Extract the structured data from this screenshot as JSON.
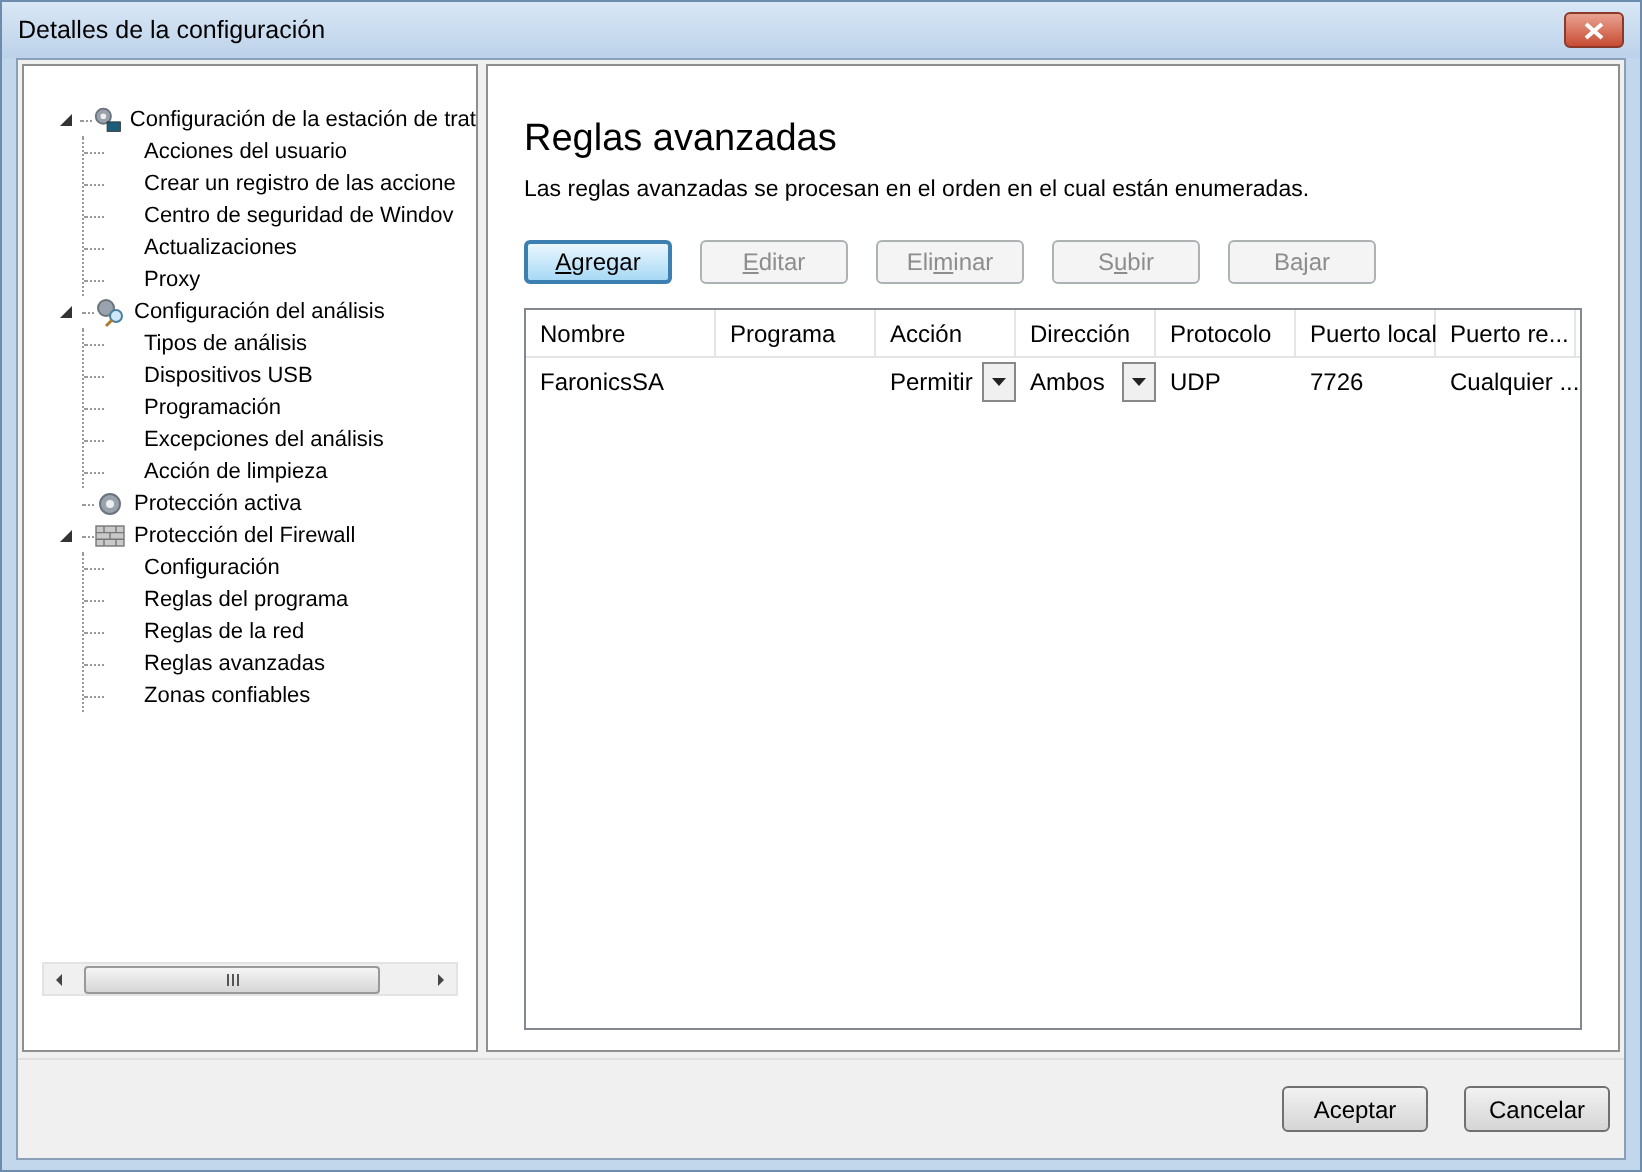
{
  "window": {
    "title": "Detalles de la configuración"
  },
  "tree": [
    {
      "label": "Configuración de la estación de trat",
      "expanded": true,
      "children": [
        {
          "label": "Acciones del usuario"
        },
        {
          "label": "Crear un registro de las accione"
        },
        {
          "label": "Centro de seguridad de Windov"
        },
        {
          "label": "Actualizaciones"
        },
        {
          "label": "Proxy"
        }
      ]
    },
    {
      "label": "Configuración del análisis",
      "expanded": true,
      "children": [
        {
          "label": "Tipos de análisis"
        },
        {
          "label": "Dispositivos USB"
        },
        {
          "label": "Programación"
        },
        {
          "label": "Excepciones del análisis"
        },
        {
          "label": "Acción de limpieza"
        }
      ]
    },
    {
      "label": "Protección activa"
    },
    {
      "label": "Protección del Firewall",
      "expanded": true,
      "children": [
        {
          "label": "Configuración"
        },
        {
          "label": "Reglas del  programa"
        },
        {
          "label": "Reglas de la red"
        },
        {
          "label": "Reglas avanzadas"
        },
        {
          "label": "Zonas confiables"
        }
      ]
    }
  ],
  "page": {
    "title": "Reglas avanzadas",
    "description": "Las reglas avanzadas se procesan en el orden en el cual están enumeradas."
  },
  "toolbar": [
    {
      "label": {
        "key": "A",
        "after": "gregar"
      },
      "disabled": false,
      "focused": true
    },
    {
      "label": {
        "key": "E",
        "after": "ditar"
      },
      "disabled": true,
      "focused": false
    },
    {
      "label": {
        "before": "Eli",
        "key": "m",
        "after": "inar"
      },
      "disabled": true,
      "focused": false
    },
    {
      "label": {
        "before": "S",
        "key": "u",
        "after": "bir"
      },
      "disabled": true,
      "focused": false
    },
    {
      "label": {
        "before": "Bajar"
      },
      "disabled": true,
      "focused": false
    }
  ],
  "table": {
    "columns": [
      "Nombre",
      "Programa",
      "Acción",
      "Dirección",
      "Protocolo",
      "Puerto local",
      "Puerto re..."
    ],
    "rows": [
      {
        "cells": [
          {
            "kind": "text",
            "value": "FaronicsSA"
          },
          {
            "kind": "text"
          },
          {
            "kind": "dropdown",
            "value": "Permitir"
          },
          {
            "kind": "dropdown",
            "value": "Ambos"
          },
          {
            "kind": "text",
            "value": "UDP"
          },
          {
            "kind": "text",
            "value": "7726"
          },
          {
            "kind": "text",
            "value": "Cualquier ..."
          }
        ]
      }
    ]
  },
  "buttons": [
    "Aceptar",
    "Cancelar"
  ]
}
